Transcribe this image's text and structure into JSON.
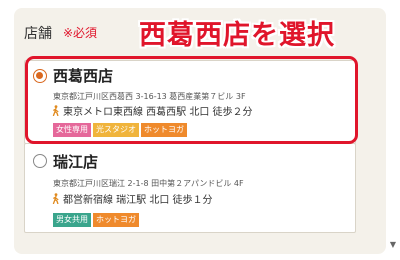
{
  "form": {
    "field_label": "店舗",
    "required_label": "※必須",
    "required_color": "#e0152b"
  },
  "annotation": {
    "text": "西葛西店を選択",
    "color": "#e0152b"
  },
  "stores": [
    {
      "name": "西葛西店",
      "selected": true,
      "address": "東京都江戸川区西葛西 3-16-13 葛西産業第７ビル 3F",
      "access": "東京メトロ東西線 西葛西駅 北口 徒歩２分",
      "tags": [
        {
          "label": "女性専用",
          "color": "#e5689a"
        },
        {
          "label": "光スタジオ",
          "color": "#f0b43c"
        },
        {
          "label": "ホットヨガ",
          "color": "#ef8a2c"
        }
      ]
    },
    {
      "name": "瑞江店",
      "selected": false,
      "address": "東京都江戸川区瑞江 2-1-8 田中第２アパンドビル 4F",
      "access": "都営新宿線 瑞江駅 北口 徒歩１分",
      "tags": [
        {
          "label": "男女共用",
          "color": "#3aa58c"
        },
        {
          "label": "ホットヨガ",
          "color": "#ef8a2c"
        }
      ]
    }
  ],
  "colors": {
    "radio_selected": "#d9681f",
    "walk_icon": "#e08a1e"
  },
  "scroll": {
    "arrow_icon": "scroll-down-icon",
    "glyph": "▼"
  }
}
